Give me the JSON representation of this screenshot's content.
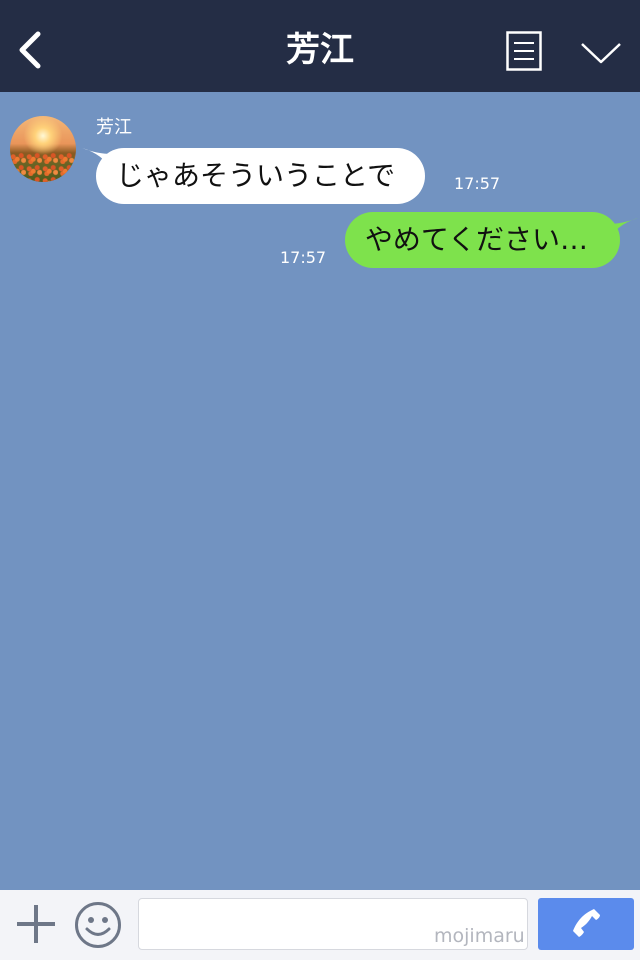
{
  "header": {
    "title": "芳江",
    "icons": [
      "back-arrow-icon",
      "menu-list-icon",
      "chevron-down-icon"
    ],
    "background": "#242d45"
  },
  "chat": {
    "background": "#7293c1",
    "messages": [
      {
        "direction": "incoming",
        "sender": "芳江",
        "text": "じゃあそういうことで",
        "time": "17:57",
        "bubble_color": "#ffffff"
      },
      {
        "direction": "outgoing",
        "text": "やめてください…",
        "time": "17:57",
        "bubble_color": "#7ee24c"
      }
    ]
  },
  "input_bar": {
    "watermark": "mojimaru",
    "input_value": "",
    "icons": [
      "plus-icon",
      "emoji-icon",
      "phone-icon"
    ],
    "call_button_color": "#5b8bec"
  }
}
